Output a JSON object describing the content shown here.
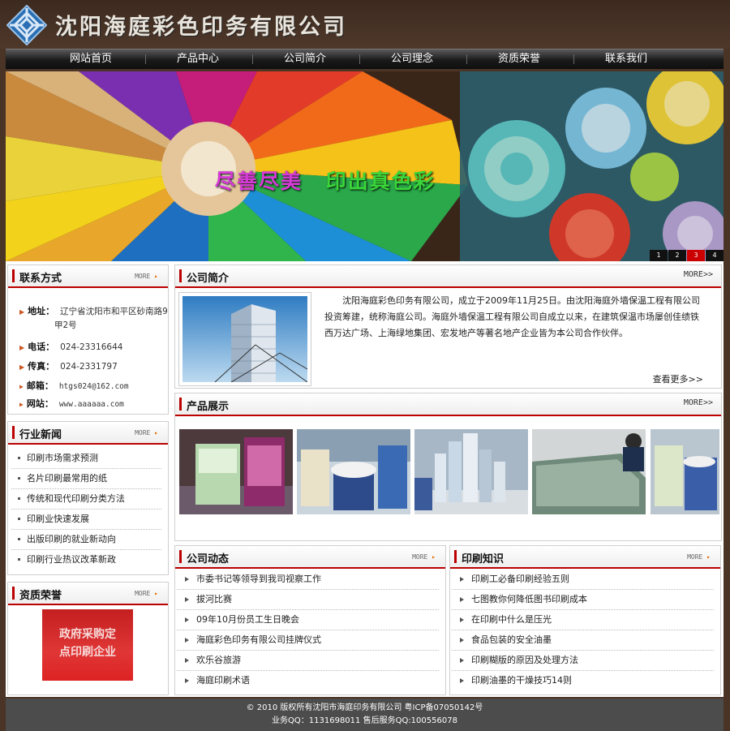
{
  "header": {
    "site_name": "沈阳海庭彩色印务有限公司",
    "logo": "spiral-logo-icon"
  },
  "nav": {
    "items": [
      {
        "label": "网站首页"
      },
      {
        "label": "产品中心"
      },
      {
        "label": "公司简介"
      },
      {
        "label": "公司理念"
      },
      {
        "label": "资质荣誉"
      },
      {
        "label": "联系我们"
      }
    ]
  },
  "banner": {
    "slogan_part1": "尽善尽美",
    "slogan_part2": "印出真色彩",
    "pages": [
      "1",
      "2",
      "3",
      "4"
    ],
    "active_page": "3"
  },
  "contact": {
    "title": "联系方式",
    "more": "MORE",
    "address_label": "地址：",
    "address_line1": "辽宁省沈阳市和平区砂南路9",
    "address_line2": "甲2号",
    "phone_label": "电话：",
    "phone": "024-23316644",
    "fax_label": "传真：",
    "fax": "024-2331797",
    "email_label": "邮箱：",
    "email": "htgs024@162.com",
    "website_label": "网站：",
    "website": "www.aaaaaa.com"
  },
  "industry_news": {
    "title": "行业新闻",
    "more": "MORE",
    "items": [
      "印刷市场需求预测",
      "名片印刷最常用的纸",
      "传统和现代印刷分类方法",
      "印刷业快速发展",
      "出版印刷的就业新动向",
      "印刷行业热议改革新政"
    ]
  },
  "honors": {
    "title": "资质荣誉",
    "more": "MORE",
    "badge_line1": "政府采购定",
    "badge_line2": "点印刷企业"
  },
  "company_intro": {
    "title": "公司简介",
    "more": "MORE>>",
    "text": "沈阳海庭彩色印务有限公司，成立于2009年11月25日。由沈阳海庭外墙保温工程有限公司投资筹建，统称海庭公司。海庭外墙保温工程有限公司自成立以来，在建筑保温市场屡创佳绩铁西万达广场、上海绿地集团、宏发地产等著名地产企业皆为本公司合作伙伴。",
    "read_more": "查看更多>>"
  },
  "products": {
    "title": "产品展示",
    "more": "MORE>>"
  },
  "company_news": {
    "title": "公司动态",
    "more": "MORE",
    "items": [
      "市委书记等领导到我司视察工作",
      "拔河比赛",
      "09年10月份员工生日晚会",
      "海庭彩色印务有限公司挂牌仪式",
      "欢乐谷旅游",
      "海庭印刷术语"
    ]
  },
  "print_knowledge": {
    "title": "印刷知识",
    "more": "MORE",
    "items": [
      "印刷工必备印刷经验五则",
      "七图教你何降低图书印刷成本",
      "在印刷中什么是压光",
      "食品包装的安全油墨",
      "印刷糊版的原因及处理方法",
      "印刷油墨的干燥技巧14则"
    ]
  },
  "footer": {
    "line1": "© 2010 版权所有沈阳市海庭印务有限公司 粤ICP备07050142号",
    "line2": "业务QQ：1131698011 售后服务QQ:100556078"
  }
}
